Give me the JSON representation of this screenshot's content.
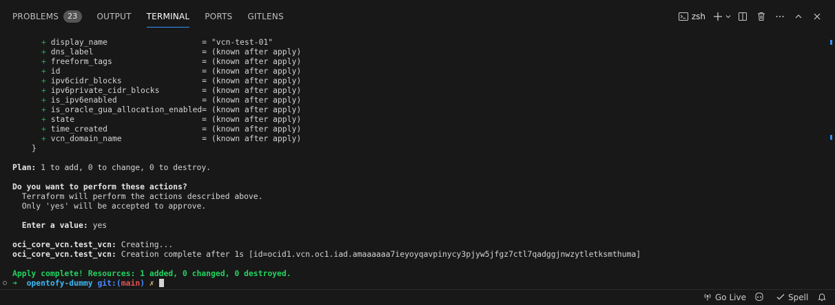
{
  "panel": {
    "tabs": [
      {
        "label": "PROBLEMS",
        "badge": "23"
      },
      {
        "label": "OUTPUT"
      },
      {
        "label": "TERMINAL",
        "active": true
      },
      {
        "label": "PORTS"
      },
      {
        "label": "GITLENS"
      }
    ],
    "shell_name": "zsh"
  },
  "terminal": {
    "attributes": [
      {
        "name": "display_name",
        "value": "\"vcn-test-01\""
      },
      {
        "name": "dns_label",
        "value": "(known after apply)"
      },
      {
        "name": "freeform_tags",
        "value": "(known after apply)"
      },
      {
        "name": "id",
        "value": "(known after apply)"
      },
      {
        "name": "ipv6cidr_blocks",
        "value": "(known after apply)"
      },
      {
        "name": "ipv6private_cidr_blocks",
        "value": "(known after apply)"
      },
      {
        "name": "is_ipv6enabled",
        "value": "(known after apply)"
      },
      {
        "name": "is_oracle_gua_allocation_enabled",
        "value": "(known after apply)"
      },
      {
        "name": "state",
        "value": "(known after apply)"
      },
      {
        "name": "time_created",
        "value": "(known after apply)"
      },
      {
        "name": "vcn_domain_name",
        "value": "(known after apply)"
      }
    ],
    "closing_brace": "}",
    "plan_label": "Plan:",
    "plan_text": " 1 to add, 0 to change, 0 to destroy.",
    "question": "Do you want to perform these actions?",
    "info_line1": "  Terraform will perform the actions described above.",
    "info_line2": "  Only 'yes' will be accepted to approve.",
    "enter_label": "  Enter a value:",
    "enter_value": " yes",
    "creating_resource": "oci_core_vcn.test_vcn:",
    "creating_text": " Creating...",
    "complete_resource": "oci_core_vcn.test_vcn:",
    "complete_text": " Creation complete after 1s [id=ocid1.vcn.oc1.iad.amaaaaaa7ieyoyqavpinycy3pjyw5jfgz7ctl7qadggjnwzytletksmthuma]",
    "apply_complete": "Apply complete! Resources: 1 added, 0 changed, 0 destroyed.",
    "prompt": {
      "arrow": "➜",
      "dir": "opentofy-dummy",
      "git_label": "git:(",
      "branch": "main",
      "git_close": ")",
      "dirty": "✗"
    }
  },
  "statusbar": {
    "go_live": "Go Live",
    "spell": "Spell"
  },
  "colors": {
    "background": "#181818",
    "plus": "#23a559",
    "apply_complete": "#23d160",
    "accent": "#3794ff"
  },
  "icons": [
    "terminal-icon",
    "plus-icon",
    "chevron-down-icon",
    "split-icon",
    "trash-icon",
    "more-icon",
    "chevron-up-icon",
    "close-icon",
    "broadcast-icon",
    "copilot-icon",
    "check-icon",
    "bell-icon"
  ]
}
